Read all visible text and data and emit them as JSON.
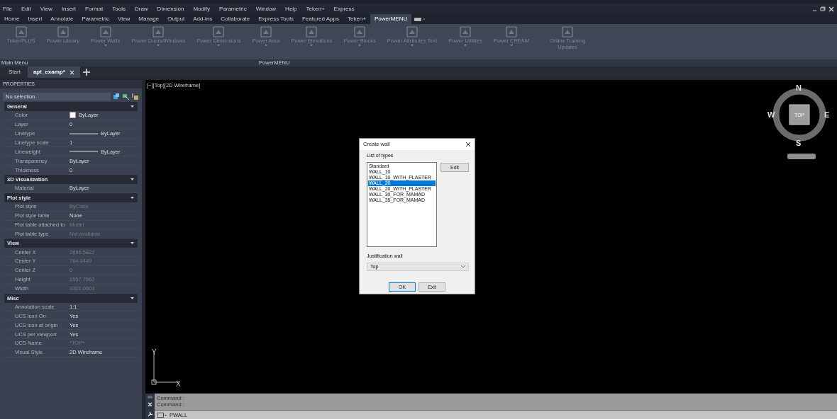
{
  "menu_bar": {
    "items": [
      "File",
      "Edit",
      "View",
      "Insert",
      "Format",
      "Tools",
      "Draw",
      "Dimension",
      "Modify",
      "Parametric",
      "Window",
      "Help",
      "Teken+",
      "Express"
    ]
  },
  "ribbon": {
    "tabs": [
      {
        "label": "Home",
        "selected": false
      },
      {
        "label": "Insert",
        "selected": false
      },
      {
        "label": "Annotate",
        "selected": false
      },
      {
        "label": "Parametric",
        "selected": false
      },
      {
        "label": "View",
        "selected": false
      },
      {
        "label": "Manage",
        "selected": false
      },
      {
        "label": "Output",
        "selected": false
      },
      {
        "label": "Add-ins",
        "selected": false
      },
      {
        "label": "Collaborate",
        "selected": false
      },
      {
        "label": "Express Tools",
        "selected": false
      },
      {
        "label": "Featured Apps",
        "selected": false
      },
      {
        "label": "Teken+",
        "selected": false
      },
      {
        "label": "PowerMENU",
        "selected": true
      }
    ],
    "buttons": [
      {
        "label": "TekenPLUS",
        "dropdown": false
      },
      {
        "label": "Power Library",
        "dropdown": false
      },
      {
        "label": "Power Walls",
        "dropdown": true
      },
      {
        "label": "Power Doors/Windows",
        "dropdown": true
      },
      {
        "label": "Power Dimensions",
        "dropdown": true
      },
      {
        "label": "Power Area",
        "dropdown": true
      },
      {
        "label": "Power Elevations",
        "dropdown": true
      },
      {
        "label": "Power Blocks",
        "dropdown": true
      },
      {
        "label": "Power Attributes Text",
        "dropdown": true
      },
      {
        "label": "Power Utilities",
        "dropdown": true
      },
      {
        "label": "Power CREAM",
        "dropdown": true
      },
      {
        "label": "Online Training Updates",
        "dropdown": false
      }
    ],
    "panels": [
      "Main Menu",
      "PowerMENU"
    ]
  },
  "document_tabs": [
    {
      "label": "Start",
      "selected": false,
      "closable": false
    },
    {
      "label": "apt_examp*",
      "selected": true,
      "closable": true
    }
  ],
  "properties": {
    "title": "PROPERTIES",
    "selection": "No selection",
    "sections": [
      {
        "title": "General",
        "rows": [
          {
            "label": "Color",
            "value": "ByLayer",
            "kind": "color",
            "disabled": false
          },
          {
            "label": "Layer",
            "value": "0",
            "kind": "text",
            "disabled": false
          },
          {
            "label": "Linetype",
            "value": "ByLayer",
            "kind": "line",
            "disabled": false
          },
          {
            "label": "Linetype scale",
            "value": "1",
            "kind": "text",
            "disabled": false
          },
          {
            "label": "Lineweight",
            "value": "ByLayer",
            "kind": "line",
            "disabled": false
          },
          {
            "label": "Transparency",
            "value": "ByLayer",
            "kind": "text",
            "disabled": false
          },
          {
            "label": "Thickness",
            "value": "0",
            "kind": "text",
            "disabled": false
          }
        ]
      },
      {
        "title": "3D Visualization",
        "rows": [
          {
            "label": "Material",
            "value": "ByLayer",
            "kind": "text",
            "disabled": false
          }
        ]
      },
      {
        "title": "Plot style",
        "rows": [
          {
            "label": "Plot style",
            "value": "ByColor",
            "kind": "text",
            "disabled": true
          },
          {
            "label": "Plot style table",
            "value": "None",
            "kind": "text",
            "disabled": false
          },
          {
            "label": "Plot table attached to",
            "value": "Model",
            "kind": "text",
            "disabled": true
          },
          {
            "label": "Plot table type",
            "value": "Not available",
            "kind": "text",
            "disabled": true
          }
        ]
      },
      {
        "title": "View",
        "rows": [
          {
            "label": "Center X",
            "value": "2896.5822",
            "kind": "text",
            "disabled": true
          },
          {
            "label": "Center Y",
            "value": "764.0449",
            "kind": "text",
            "disabled": true
          },
          {
            "label": "Center Z",
            "value": "0",
            "kind": "text",
            "disabled": true
          },
          {
            "label": "Height",
            "value": "1557.7662",
            "kind": "text",
            "disabled": true
          },
          {
            "label": "Width",
            "value": "3301.0603",
            "kind": "text",
            "disabled": true
          }
        ]
      },
      {
        "title": "Misc",
        "rows": [
          {
            "label": "Annotation scale",
            "value": "1:1",
            "kind": "text",
            "disabled": false
          },
          {
            "label": "UCS icon On",
            "value": "Yes",
            "kind": "text",
            "disabled": false
          },
          {
            "label": "UCS icon at origin",
            "value": "Yes",
            "kind": "text",
            "disabled": false
          },
          {
            "label": "UCS per viewport",
            "value": "Yes",
            "kind": "text",
            "disabled": false
          },
          {
            "label": "UCS Name",
            "value": "*TOP*",
            "kind": "text",
            "disabled": true
          },
          {
            "label": "Visual Style",
            "value": "2D Wireframe",
            "kind": "text",
            "disabled": false
          }
        ]
      }
    ]
  },
  "viewport": {
    "label": "[−][Top][2D Wireframe]",
    "viewcube": {
      "top": "TOP",
      "north": "N",
      "south": "S",
      "east": "E",
      "west": "W"
    },
    "ucs": {
      "x": "X",
      "y": "Y"
    }
  },
  "dialog": {
    "title": "Create wall",
    "list_label": "List of types",
    "types": [
      {
        "label": "Standard",
        "selected": false
      },
      {
        "label": "WALL_10",
        "selected": false
      },
      {
        "label": "WALL_10_WITH_PLASTER",
        "selected": false
      },
      {
        "label": "WALL_20",
        "selected": true
      },
      {
        "label": "WALL_20_WITH_PLASTER",
        "selected": false
      },
      {
        "label": "WALL_30_FOR_MAMAD",
        "selected": false
      },
      {
        "label": "WALL_35_FOR_MAMAD",
        "selected": false
      }
    ],
    "edit_button": "Edit",
    "justification_label": "Justification wall",
    "justification": "Top",
    "ok_button": "OK",
    "exit_button": "Exit"
  },
  "command_line": {
    "history": [
      "Command :",
      "Command :"
    ],
    "input": "PWALL"
  }
}
